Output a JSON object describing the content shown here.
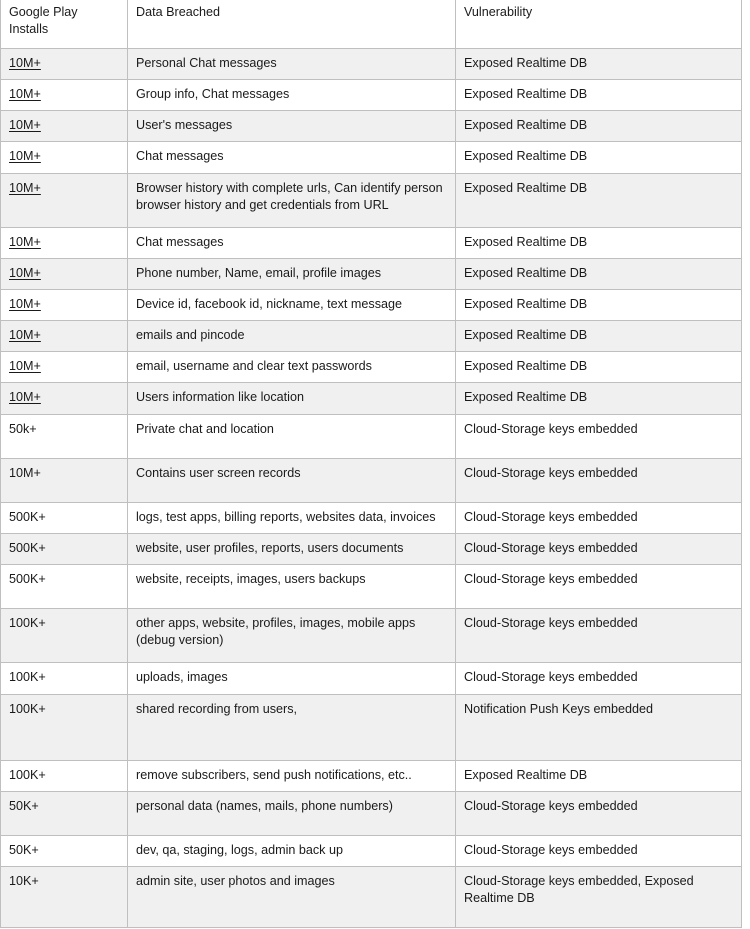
{
  "document": {
    "title": "Google Play Installs / Data Breached / Vulnerability",
    "cutoff_row_note": "partially clipped row above the table header"
  },
  "table": {
    "columns": [
      {
        "key": "installs",
        "label": "Google Play Installs"
      },
      {
        "key": "data_breached",
        "label": "Data Breached"
      },
      {
        "key": "vulnerability",
        "label": "Vulnerability"
      }
    ],
    "header": {
      "installs": "Google Play Installs",
      "data_breached": "Data Breached",
      "vulnerability": "Vulnerability"
    },
    "rows": [
      {
        "installs": "10M+",
        "installs_underlined": true,
        "data_breached": "Personal Chat messages",
        "vulnerability": "Exposed Realtime DB",
        "shaded": true
      },
      {
        "installs": "10M+",
        "installs_underlined": true,
        "data_breached": "Group info, Chat messages",
        "vulnerability": "Exposed Realtime DB",
        "shaded": false
      },
      {
        "installs": "10M+",
        "installs_underlined": true,
        "data_breached": "User's messages",
        "vulnerability": "Exposed Realtime DB",
        "shaded": true
      },
      {
        "installs": "10M+",
        "installs_underlined": true,
        "data_breached": "Chat messages",
        "vulnerability": "Exposed Realtime DB",
        "shaded": false
      },
      {
        "installs": "10M+",
        "installs_underlined": true,
        "data_breached": "Browser history with complete urls, Can identify person browser history and get credentials from URL",
        "vulnerability": "Exposed Realtime DB",
        "shaded": true
      },
      {
        "installs": "10M+",
        "installs_underlined": true,
        "data_breached": "Chat messages",
        "vulnerability": "Exposed Realtime DB",
        "shaded": false
      },
      {
        "installs": "10M+",
        "installs_underlined": true,
        "data_breached": "Phone number, Name, email, profile images",
        "vulnerability": "Exposed Realtime DB",
        "shaded": true
      },
      {
        "installs": "10M+",
        "installs_underlined": true,
        "data_breached": "Device id, facebook id, nickname, text message",
        "vulnerability": "Exposed Realtime DB",
        "shaded": false
      },
      {
        "installs": "10M+",
        "installs_underlined": true,
        "data_breached": "emails and pincode",
        "vulnerability": "Exposed Realtime DB",
        "shaded": true
      },
      {
        "installs": "10M+",
        "installs_underlined": true,
        "data_breached": "email, username and clear text passwords",
        "vulnerability": "Exposed Realtime DB",
        "shaded": false
      },
      {
        "installs": "10M+",
        "installs_underlined": true,
        "data_breached": "Users information like location",
        "vulnerability": "Exposed Realtime DB",
        "shaded": true
      },
      {
        "installs": "50k+",
        "installs_underlined": false,
        "data_breached": "Private chat and location",
        "vulnerability": "Cloud-Storage keys embedded",
        "shaded": false
      },
      {
        "installs": "10M+",
        "installs_underlined": false,
        "data_breached": "Contains user screen records",
        "vulnerability": "Cloud-Storage keys embedded",
        "shaded": true
      },
      {
        "installs": "500K+",
        "installs_underlined": false,
        "data_breached": "logs, test apps, billing reports, websites data, invoices",
        "vulnerability": "Cloud-Storage keys embedded",
        "shaded": false
      },
      {
        "installs": "500K+",
        "installs_underlined": false,
        "data_breached": "website, user profiles, reports, users documents",
        "vulnerability": "Cloud-Storage keys embedded",
        "shaded": true
      },
      {
        "installs": "500K+",
        "installs_underlined": false,
        "data_breached": "website, receipts, images, users backups",
        "vulnerability": "Cloud-Storage keys embedded",
        "shaded": false
      },
      {
        "installs": "100K+",
        "installs_underlined": false,
        "data_breached": "other apps, website, profiles, images, mobile apps (debug version)",
        "vulnerability": "Cloud-Storage keys embedded",
        "shaded": true
      },
      {
        "installs": "100K+",
        "installs_underlined": false,
        "data_breached": "uploads, images",
        "vulnerability": "Cloud-Storage keys embedded",
        "shaded": false
      },
      {
        "installs": "100K+",
        "installs_underlined": false,
        "data_breached": "shared recording from users,",
        "vulnerability": "Notification Push Keys embedded",
        "shaded": true
      },
      {
        "installs": "100K+",
        "installs_underlined": false,
        "data_breached": "remove subscribers, send push notifications, etc..",
        "vulnerability": "Exposed Realtime DB",
        "shaded": false
      },
      {
        "installs": "50K+",
        "installs_underlined": false,
        "data_breached": "personal data (names, mails, phone numbers)",
        "vulnerability": "Cloud-Storage keys embedded",
        "shaded": true
      },
      {
        "installs": "50K+",
        "installs_underlined": false,
        "data_breached": "dev, qa, staging, logs, admin back up",
        "vulnerability": "Cloud-Storage keys embedded",
        "shaded": false
      },
      {
        "installs": "10K+",
        "installs_underlined": false,
        "data_breached": "admin site, user photos and images",
        "vulnerability": "Cloud-Storage keys embedded, Exposed Realtime DB",
        "shaded": true
      }
    ]
  }
}
